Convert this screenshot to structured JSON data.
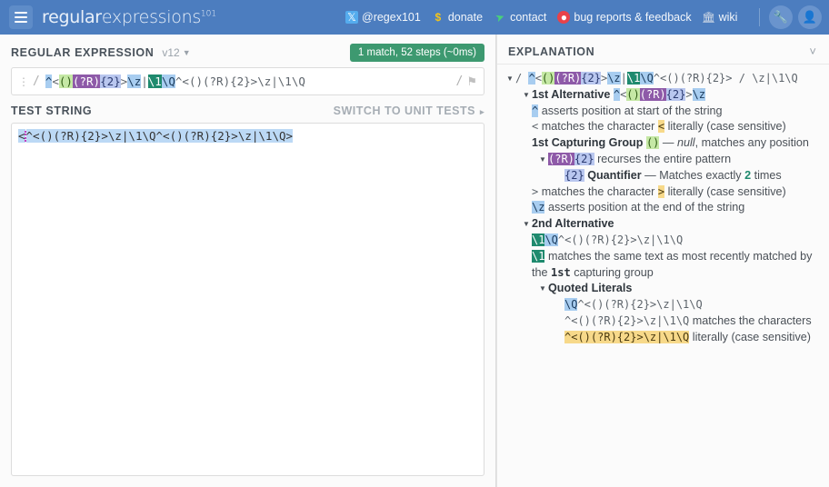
{
  "header": {
    "logo_main": "regular",
    "logo_sub": "expressions",
    "logo_sup": "101",
    "menu_icon": "hamburger-icon",
    "links": [
      {
        "label": "@regex101",
        "icon": "twitter-icon"
      },
      {
        "label": "donate",
        "icon": "dollar-icon"
      },
      {
        "label": "contact",
        "icon": "paper-plane-icon"
      },
      {
        "label": "bug reports & feedback",
        "icon": "github-icon"
      },
      {
        "label": "wiki",
        "icon": "bank-icon"
      }
    ],
    "tool_icon": "wrench-icon",
    "account_icon": "user-icon"
  },
  "regex_panel": {
    "title": "REGULAR EXPRESSION",
    "version": "v12",
    "match_badge": "1 match, 52 steps (~0ms)",
    "open_delimiter": "/",
    "close_delimiter": "/",
    "flags": "",
    "flag_icon": "flag-icon",
    "drag_icon": "drag-handle-icon",
    "pattern_plain": "^<()(?R){2}>\\z|\\1\\Q^<()(?R){2}>\\z|\\1\\Q",
    "tokens": [
      {
        "text": "^",
        "style": "anchor"
      },
      {
        "text": "<",
        "style": "plain"
      },
      {
        "text": "()",
        "style": "group"
      },
      {
        "text": "(?R)",
        "style": "recurse"
      },
      {
        "text": "{2}",
        "style": "quant"
      },
      {
        "text": ">",
        "style": "plain"
      },
      {
        "text": "\\z",
        "style": "anchor"
      },
      {
        "text": "|",
        "style": "plain"
      },
      {
        "text": "\\1",
        "style": "backref"
      },
      {
        "text": "\\Q",
        "style": "anchor"
      },
      {
        "text": "^<()(?R){2}>\\z|\\1\\Q",
        "style": "plain"
      }
    ]
  },
  "test_panel": {
    "title": "TEST STRING",
    "switch_label": "SWITCH TO UNIT TESTS",
    "switch_arrow": "▸",
    "content_before": "<",
    "content_match": "^<()(?R){2}>\\z|\\1\\Q^<()(?R){2}>\\z|\\1\\Q>"
  },
  "explanation": {
    "title": "EXPLANATION",
    "collapse_icon": "chevron-down-icon",
    "rows": [
      {
        "level": 1,
        "tri": "▼",
        "parts": [
          {
            "t": "/ ",
            "s": "plain-mono"
          },
          {
            "t": "^",
            "s": "anchor"
          },
          {
            "t": "<",
            "s": "plain-mono"
          },
          {
            "t": "()",
            "s": "group"
          },
          {
            "t": "(?R)",
            "s": "recurse"
          },
          {
            "t": "{2}",
            "s": "quant"
          },
          {
            "t": ">",
            "s": "plain-mono"
          },
          {
            "t": "\\z",
            "s": "anchor"
          },
          {
            "t": "|",
            "s": "plain-mono"
          },
          {
            "t": "\\1",
            "s": "backref"
          },
          {
            "t": "\\Q",
            "s": "anchor"
          },
          {
            "t": "^<()(?R){2}>",
            "s": "plain-mono"
          },
          {
            "t": " / ",
            "s": "plain-mono"
          },
          {
            "t": "\\z|\\1\\Q",
            "s": "plain-mono"
          }
        ]
      },
      {
        "level": 2,
        "tri": "▼",
        "parts": [
          {
            "t": "1st Alternative ",
            "s": "bold"
          },
          {
            "t": "^",
            "s": "anchor"
          },
          {
            "t": "<",
            "s": "plain-mono"
          },
          {
            "t": "()",
            "s": "group"
          },
          {
            "t": "(?R)",
            "s": "recurse"
          },
          {
            "t": "{2}",
            "s": "quant"
          },
          {
            "t": ">",
            "s": "plain-mono"
          },
          {
            "t": "\\z",
            "s": "anchor"
          }
        ]
      },
      {
        "level": 2,
        "tri": "",
        "parts": [
          {
            "t": "^",
            "s": "anchor"
          },
          {
            "t": " asserts position at start of the string",
            "s": "plain"
          }
        ]
      },
      {
        "level": 2,
        "tri": "",
        "parts": [
          {
            "t": "<",
            "s": "plain-mono"
          },
          {
            "t": " matches the character ",
            "s": "plain"
          },
          {
            "t": "<",
            "s": "lit"
          },
          {
            "t": " literally (case sensitive)",
            "s": "plain"
          }
        ]
      },
      {
        "level": 2,
        "tri": "",
        "parts": [
          {
            "t": "1st Capturing Group ",
            "s": "bold"
          },
          {
            "t": "()",
            "s": "group"
          },
          {
            "t": " — ",
            "s": "plain"
          },
          {
            "t": "null",
            "s": "ital"
          },
          {
            "t": ", matches any position",
            "s": "plain"
          }
        ]
      },
      {
        "level": 3,
        "tri": "▼",
        "parts": [
          {
            "t": "(?R)",
            "s": "recurse"
          },
          {
            "t": "{2}",
            "s": "quant"
          },
          {
            "t": " recurses the entire pattern",
            "s": "plain"
          }
        ]
      },
      {
        "level": 4,
        "tri": "",
        "parts": [
          {
            "t": "{2}",
            "s": "quant"
          },
          {
            "t": " ",
            "s": "plain"
          },
          {
            "t": "Quantifier",
            "s": "bold"
          },
          {
            "t": " — Matches exactly ",
            "s": "plain"
          },
          {
            "t": "2",
            "s": "num"
          },
          {
            "t": " times",
            "s": "plain"
          }
        ]
      },
      {
        "level": 2,
        "tri": "",
        "parts": [
          {
            "t": ">",
            "s": "plain-mono"
          },
          {
            "t": " matches the character ",
            "s": "plain"
          },
          {
            "t": ">",
            "s": "lit"
          },
          {
            "t": " literally (case sensitive)",
            "s": "plain"
          }
        ]
      },
      {
        "level": 2,
        "tri": "",
        "parts": [
          {
            "t": "\\z",
            "s": "anchor"
          },
          {
            "t": " asserts position at the end of the string",
            "s": "plain"
          }
        ]
      },
      {
        "level": 2,
        "tri": "▼",
        "parts": [
          {
            "t": "2nd Alternative",
            "s": "bold"
          }
        ]
      },
      {
        "level": 2,
        "tri": "",
        "parts": [
          {
            "t": "\\1",
            "s": "backref"
          },
          {
            "t": "\\Q",
            "s": "anchor"
          },
          {
            "t": "^<()(?R){2}>\\z|\\1\\Q",
            "s": "plain-mono"
          }
        ]
      },
      {
        "level": 2,
        "tri": "",
        "parts": [
          {
            "t": "\\1",
            "s": "backref"
          },
          {
            "t": " matches the same text as most recently matched by the ",
            "s": "plain"
          },
          {
            "t": "1st",
            "s": "mono-strong"
          },
          {
            "t": " capturing group",
            "s": "plain"
          }
        ]
      },
      {
        "level": 3,
        "tri": "▼",
        "parts": [
          {
            "t": "Quoted Literals",
            "s": "bold"
          }
        ]
      },
      {
        "level": 4,
        "tri": "",
        "parts": [
          {
            "t": "\\Q",
            "s": "anchor"
          },
          {
            "t": "^<()(?R){2}>\\z|\\1\\Q",
            "s": "plain-mono"
          }
        ]
      },
      {
        "level": 4,
        "tri": "",
        "parts": [
          {
            "t": "^<()(?R){2}>\\z|\\1\\Q",
            "s": "plain-mono"
          },
          {
            "t": " matches the characters ",
            "s": "plain"
          },
          {
            "t": "^<()(?R){2}>\\z|\\1\\Q",
            "s": "lit"
          },
          {
            "t": " literally (case sensitive)",
            "s": "plain"
          }
        ]
      }
    ]
  }
}
